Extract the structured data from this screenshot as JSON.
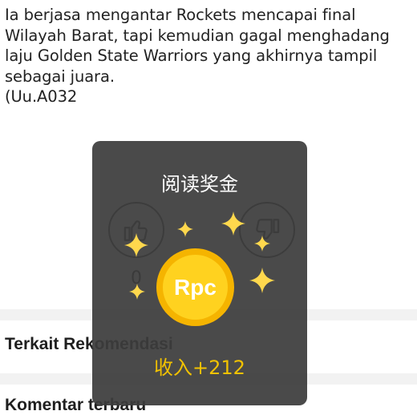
{
  "article": {
    "paragraph": "Ia berjasa mengantar Rockets mencapai final Wilayah Barat, tapi kemudian gagal menghadang laju Golden State Warriors yang akhirnya tampil sebagai juara.",
    "code": "(Uu.A032"
  },
  "votes": {
    "like_count": "0",
    "like_icon": "thumbs-up-icon",
    "dislike_icon": "thumbs-down-icon"
  },
  "sections": {
    "recommendations": "Terkait Rekomendasi",
    "comments": "Komentar terbaru"
  },
  "reward_popup": {
    "title": "阅读奖金",
    "coin_label": "Rpc",
    "income": "收入+212",
    "colors": {
      "background": "#3c3c3c",
      "coin": "#ffd21f",
      "coin_ring": "#f5b400",
      "income": "#f2c200",
      "sparkle": "#ffd84d"
    }
  }
}
